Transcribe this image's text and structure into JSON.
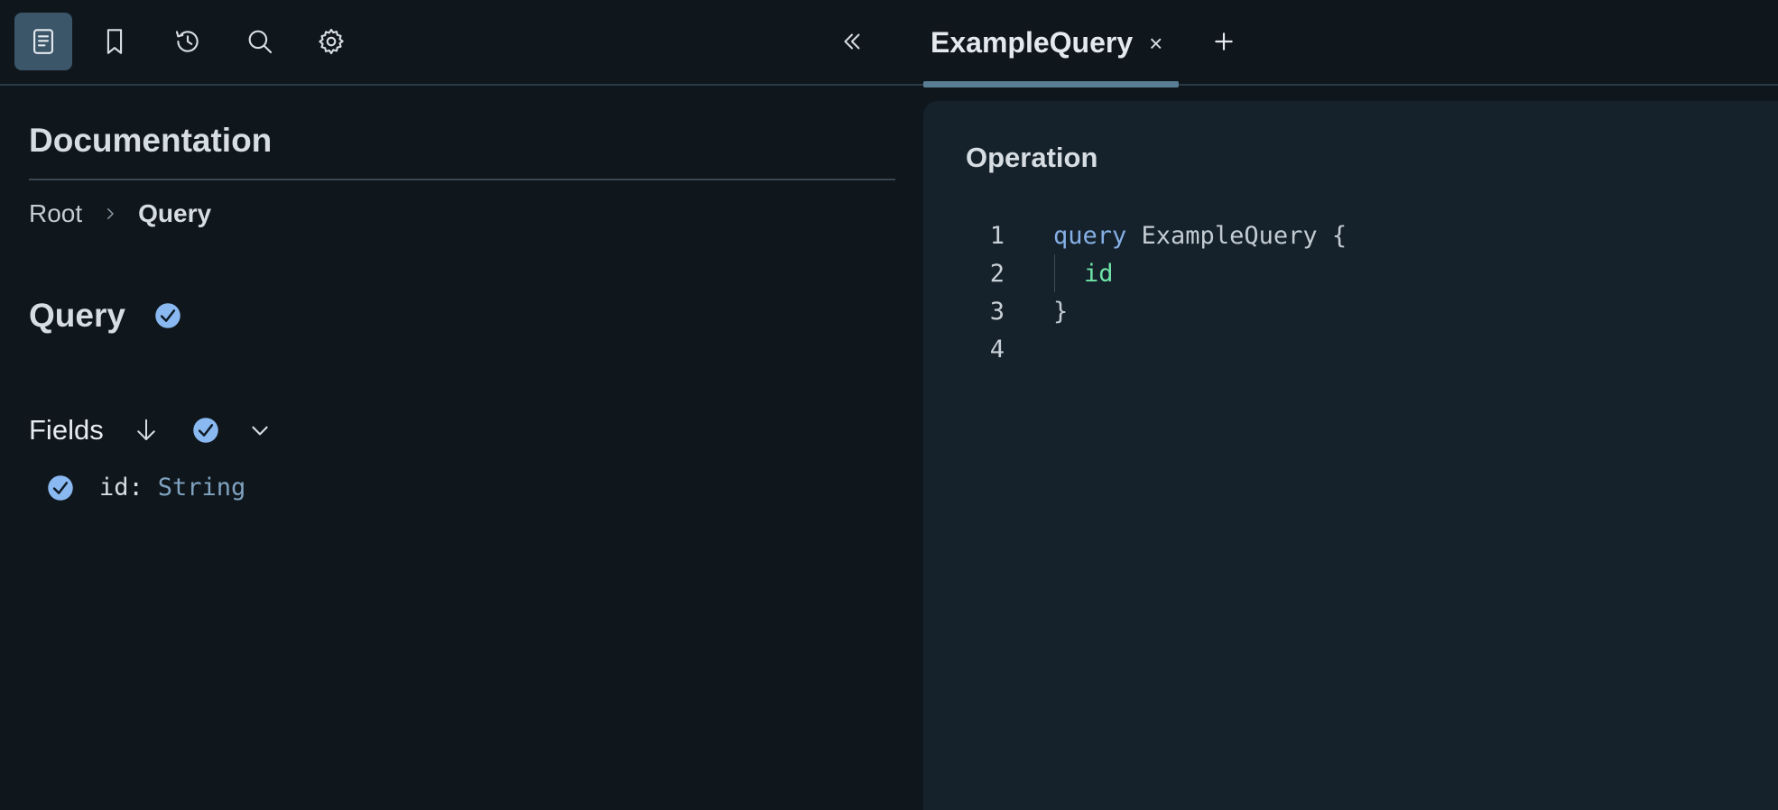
{
  "toolbar": {
    "items": [
      {
        "name": "docs",
        "icon": "document-icon",
        "active": true
      },
      {
        "name": "bookmarks",
        "icon": "bookmark-icon",
        "active": false
      },
      {
        "name": "history",
        "icon": "history-icon",
        "active": false
      },
      {
        "name": "search",
        "icon": "search-icon",
        "active": false
      },
      {
        "name": "settings",
        "icon": "gear-icon",
        "active": false
      }
    ],
    "collapse_icon": "chevrons-left-icon"
  },
  "tabs": [
    {
      "label": "ExampleQuery",
      "close_label": "×",
      "active": true
    }
  ],
  "add_tab_icon": "plus-icon",
  "documentation": {
    "title": "Documentation",
    "breadcrumb": {
      "root": "Root",
      "current": "Query"
    },
    "type_name": "Query",
    "fields_label": "Fields",
    "fields": [
      {
        "name": "id",
        "colon": ":",
        "type": "String"
      }
    ]
  },
  "editor": {
    "title": "Operation",
    "lines": [
      {
        "number": "1",
        "keyword": "query",
        "rest": " ExampleQuery {"
      },
      {
        "number": "2",
        "field": "id"
      },
      {
        "number": "3",
        "punct": "}"
      },
      {
        "number": "4"
      }
    ]
  },
  "colors": {
    "background": "#10171c",
    "editor_background": "#16222b",
    "active_tool": "#3b5569",
    "tab_underline": "#5a7d96",
    "check_badge": "#8ab8f0",
    "keyword": "#85b0e6",
    "field_token": "#6fe3a8",
    "type_link": "#7fa3c1"
  }
}
